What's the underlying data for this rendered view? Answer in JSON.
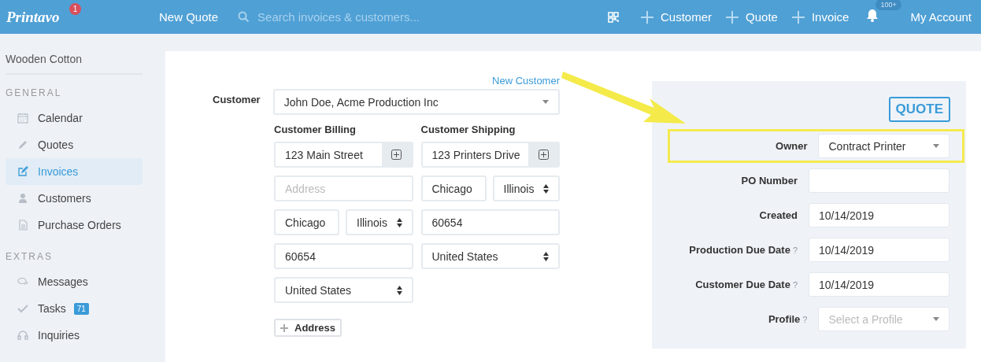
{
  "topbar": {
    "logo": "Printavo",
    "logo_badge": "1",
    "new_quote": "New Quote",
    "search": {
      "placeholder": "Search invoices & customers..."
    },
    "actions": [
      "Customer",
      "Quote",
      "Invoice"
    ],
    "notifications_badge": "100+",
    "account": "My Account"
  },
  "sidebar": {
    "company": "Wooden Cotton",
    "sections": [
      {
        "heading": "GENERAL",
        "items": [
          {
            "label": "Calendar",
            "selected": false
          },
          {
            "label": "Quotes",
            "selected": false
          },
          {
            "label": "Invoices",
            "selected": true
          },
          {
            "label": "Customers",
            "selected": false
          },
          {
            "label": "Purchase Orders",
            "selected": false
          }
        ]
      },
      {
        "heading": "EXTRAS",
        "items": [
          {
            "label": "Messages",
            "selected": false
          },
          {
            "label": "Tasks",
            "selected": false,
            "badge": "71"
          },
          {
            "label": "Inquiries",
            "selected": false
          }
        ]
      }
    ]
  },
  "form": {
    "new_customer_link": "New Customer",
    "customer_label": "Customer",
    "customer_value": "John Doe, Acme Production Inc",
    "addresses": [
      {
        "title": "Customer Billing",
        "rows": [
          [
            {
              "kind": "addon",
              "value": "123 Main Street"
            }
          ],
          [
            {
              "kind": "input",
              "placeholder": "Address"
            }
          ],
          [
            {
              "kind": "input",
              "value": "Chicago"
            },
            {
              "kind": "select",
              "value": "Illinois"
            }
          ],
          [
            {
              "kind": "input",
              "value": "60654"
            }
          ],
          [
            {
              "kind": "select",
              "value": "United States"
            }
          ]
        ]
      },
      {
        "title": "Customer Shipping",
        "rows": [
          [
            {
              "kind": "addon",
              "value": "123 Printers Drive"
            }
          ],
          [
            {
              "kind": "input",
              "value": "Chicago"
            },
            {
              "kind": "select",
              "value": "Illinois"
            }
          ],
          [
            {
              "kind": "input",
              "value": "60654"
            }
          ],
          [
            {
              "kind": "select",
              "value": "United States"
            }
          ]
        ]
      }
    ],
    "add_address": "Address"
  },
  "details": {
    "quote_button": "QUOTE",
    "fields": [
      {
        "label": "Owner",
        "kind": "dropdown",
        "value": "Contract Printer",
        "highlighted": true
      },
      {
        "label": "PO Number",
        "kind": "input",
        "highlighted": false
      },
      {
        "label": "Created",
        "kind": "input",
        "value": "10/14/2019",
        "highlighted": false
      },
      {
        "label": "Production Due Date",
        "hint": "?",
        "kind": "input",
        "value": "10/14/2019",
        "highlighted": false
      },
      {
        "label": "Customer Due Date",
        "hint": "?",
        "kind": "input",
        "value": "10/14/2019",
        "highlighted": false
      },
      {
        "label": "Profile",
        "hint": "?",
        "kind": "dropdown",
        "placeholder": "Select a Profile",
        "highlighted": false
      }
    ]
  }
}
